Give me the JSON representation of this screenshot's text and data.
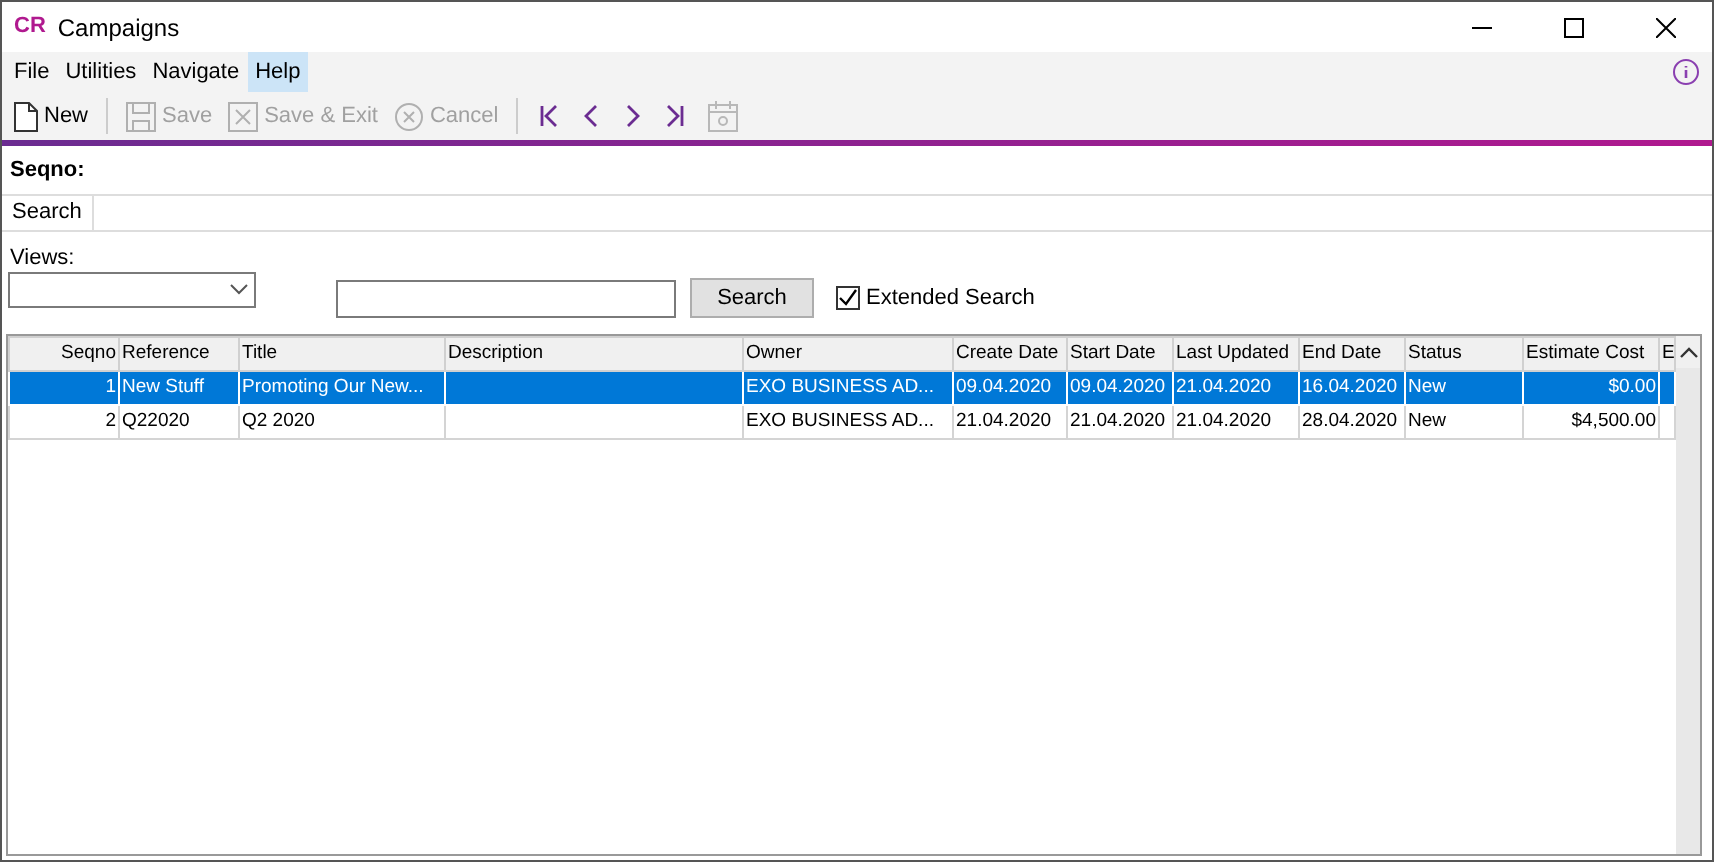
{
  "window": {
    "logo": "CR",
    "title": "Campaigns"
  },
  "menu": [
    {
      "label": "File",
      "selected": false
    },
    {
      "label": "Utilities",
      "selected": false
    },
    {
      "label": "Navigate",
      "selected": false
    },
    {
      "label": "Help",
      "selected": true
    }
  ],
  "toolbar": [
    {
      "kind": "new",
      "label": "New",
      "disabled": false
    },
    {
      "kind": "save",
      "label": "Save",
      "disabled": true
    },
    {
      "kind": "saveexit",
      "label": "Save & Exit",
      "disabled": true
    },
    {
      "kind": "cancel",
      "label": "Cancel",
      "disabled": true
    }
  ],
  "nav_buttons": [
    {
      "kind": "first",
      "disabled": false
    },
    {
      "kind": "prev",
      "disabled": false
    },
    {
      "kind": "next",
      "disabled": false
    },
    {
      "kind": "last",
      "disabled": false
    },
    {
      "kind": "calendar",
      "disabled": true
    }
  ],
  "record_label": "Seqno:",
  "tabs": [
    {
      "label": "Search",
      "selected": true
    }
  ],
  "views": {
    "label": "Views:"
  },
  "search": {
    "button": "Search",
    "extended_label": "Extended Search",
    "extended_checked": true
  },
  "table": {
    "columns": [
      "Seqno",
      "Reference",
      "Title",
      "Description",
      "Owner",
      "Create Date",
      "Start Date",
      "Last Updated",
      "End Date",
      "Status",
      "Estimate Cost",
      "E"
    ],
    "rows": [
      {
        "selected": true,
        "cells": [
          "1",
          "New Stuff",
          "Promoting Our New...",
          "",
          "EXO BUSINESS AD...",
          "09.04.2020",
          "09.04.2020",
          "21.04.2020",
          "16.04.2020",
          "New",
          "$0.00",
          ""
        ]
      },
      {
        "selected": false,
        "cells": [
          "2",
          "Q22020",
          "Q2 2020",
          "",
          "EXO BUSINESS AD...",
          "21.04.2020",
          "21.04.2020",
          "21.04.2020",
          "28.04.2020",
          "New",
          "$4,500.00",
          ""
        ]
      }
    ]
  }
}
